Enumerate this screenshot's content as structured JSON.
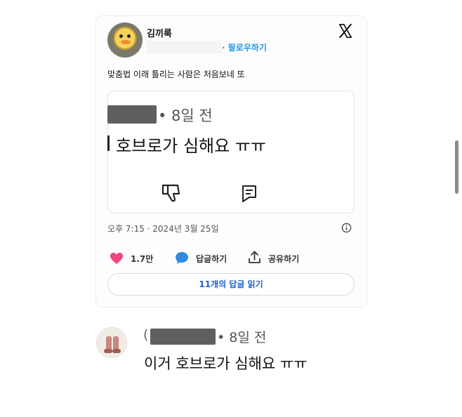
{
  "post": {
    "username": "김끼룩",
    "follow_label": "· 팔로우하기",
    "text": "맞춤법 이래 틀리는 사람은 처음보네 또",
    "quoted": {
      "time": "• 8일 전",
      "text": "호브로가 심해요 ㅠㅠ"
    },
    "meta": "오후 7:15 · 2024년 3월 25일",
    "like_count": "1.7만",
    "reply_label": "답글하기",
    "share_label": "공유하기",
    "read_replies_label": "11개의 답글 읽기"
  },
  "comment": {
    "paren": "(",
    "time": "• 8일 전",
    "text": "이거 호브로가 심해요 ㅠㅠ"
  },
  "colors": {
    "accent": "#1d9bf0",
    "like": "#f0467c",
    "reply": "#2f8be0",
    "redaction": "#5f5f5f"
  },
  "icons": [
    "x-logo-icon",
    "thumbs-down-icon",
    "comment-icon",
    "info-icon",
    "heart-icon",
    "reply-bubble-icon",
    "share-icon"
  ]
}
